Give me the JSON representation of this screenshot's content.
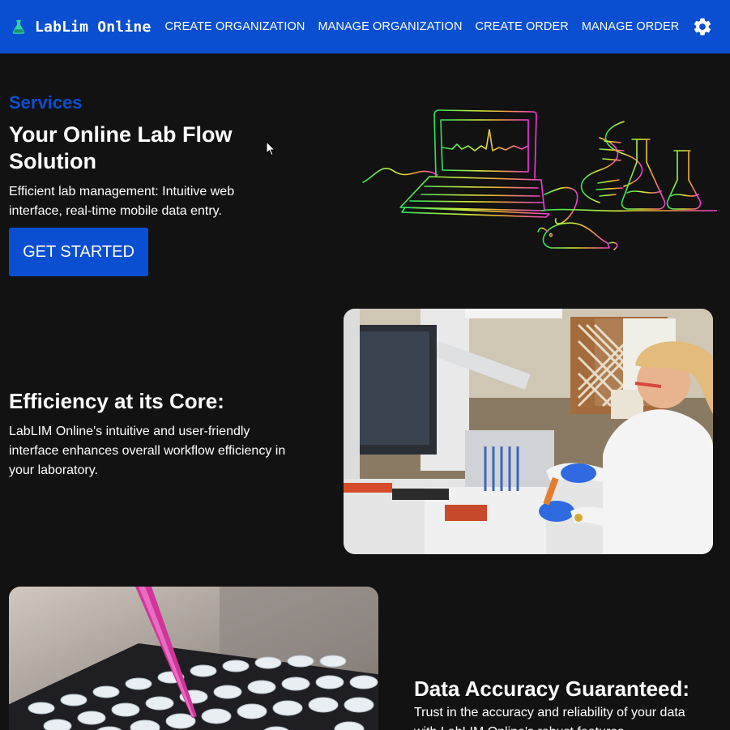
{
  "app": {
    "brand": "LabLim Online",
    "brand_icon": "flask-icon",
    "accent_color": "#0a4fd1",
    "background_color": "#121212"
  },
  "nav": {
    "items": [
      {
        "label": "CREATE ORGANIZATION"
      },
      {
        "label": "MANAGE ORGANIZATION"
      },
      {
        "label": "CREATE ORDER"
      },
      {
        "label": "MANAGE ORDER"
      }
    ],
    "settings_icon": "gear-icon"
  },
  "hero": {
    "kicker": "Services",
    "title": "Your Online Lab Flow Solution",
    "description": "Efficient lab management: Intuitive web interface, real-time mobile data entry.",
    "cta_label": "GET STARTED",
    "illustration": "lab-line-art-illustration"
  },
  "features": [
    {
      "title": "Efficiency at its Core:",
      "description": "LabLIM Online's intuitive and user-friendly interface enhances overall workflow efficiency in your laboratory.",
      "image": "scientist-at-lab-instrument-photo"
    },
    {
      "title": "Data Accuracy Guaranteed:",
      "description": "Trust in the accuracy and reliability of your data with LabLIM Online's robust features.",
      "image": "pipette-and-sample-tubes-photo"
    }
  ]
}
